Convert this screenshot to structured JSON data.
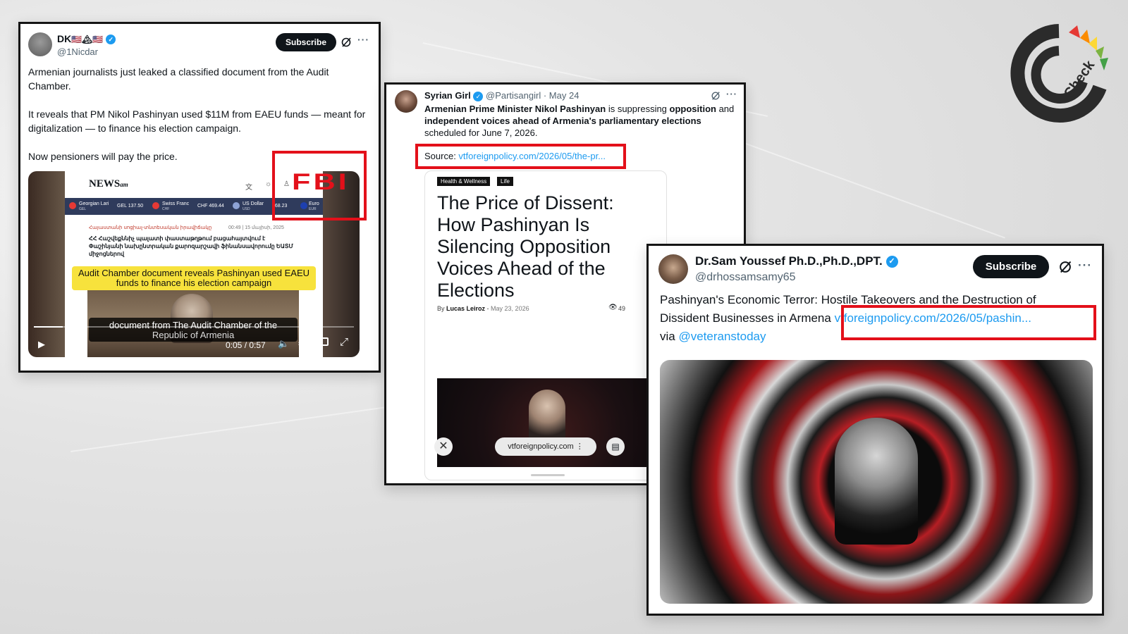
{
  "logo": {
    "letters": "Check"
  },
  "tweet1": {
    "name": "DK",
    "name_flags": "🇺🇸🏔🇺🇸",
    "handle": "@1Nicdar",
    "subscribe": "Subscribe",
    "para1": "Armenian journalists just leaked a classified document from the Audit Chamber.",
    "para2": "It reveals that PM Nikol Pashinyan used $11M from EAEU funds — meant for digitalization — to finance his election campaign.",
    "para3": "Now pensioners will pay the price.",
    "overlay_stamp": "FBI",
    "video": {
      "site_logo": "NEWS",
      "site_logo_suffix": "am",
      "rates": [
        {
          "label": "Georgian Lari",
          "code": "GEL",
          "value": "GEL 137.50"
        },
        {
          "label": "Swiss Franc",
          "code": "CHF",
          "value": "CHF 469.44"
        },
        {
          "label": "US Dollar",
          "code": "USD",
          "value": "368.23"
        },
        {
          "label": "Euro",
          "code": "EUR",
          "value": ""
        }
      ],
      "article_meta": "Հայաստանի սոցիալ-տնտեսական իրավիճակը",
      "article_time": "00:49 | 15 մայիսի, 2025",
      "article_headline": "ՀՀ Հաշվեքննիչ պալատի փաստաթղթում բացահայտվում է Փաշինյանի նախընտրական քարոզարշավի ֆինանսավորումը ԵԱՏՄ միջոցներով",
      "highlight_caption": "Audit Chamber document reveals Pashinyan used EAEU funds to finance his election campaign",
      "subtitle_line1": "document from The Audit Chamber of the",
      "subtitle_line2": "Republic of Armenia",
      "time": "0:05 / 0:57"
    }
  },
  "tweet2": {
    "name": "Syrian Girl",
    "handle": "@Partisangirl",
    "date": "· May 24",
    "text_bold1": "Armenian Prime Minister Nikol Pashinyan",
    "text_mid1": " is suppressing ",
    "text_bold2": "opposition",
    "text_mid2": " and ",
    "text_bold3": "independent voices ahead of Armenia's parliamentary elections",
    "text_end": " scheduled for June 7, 2026.",
    "source_label": "Source: ",
    "source_link": "vtforeignpolicy.com/2026/05/the-pr...",
    "article": {
      "tag1": "Health & Wellness",
      "tag2": "Life",
      "headline": "The Price of Dissent: How Pashinyan Is Silencing Opposition Voices Ahead of the Elections",
      "by": "By",
      "author": "Lucas Leiroz",
      "date": "May 23, 2026",
      "views": "49",
      "url_pill": "vtforeignpolicy.com"
    }
  },
  "tweet3": {
    "name": "Dr.Sam Youssef Ph.D.,Ph.D.,DPT.",
    "handle": "@drhossamsamy65",
    "subscribe": "Subscribe",
    "line1": "Pashinyan's Economic Terror: Hostile Takeovers and the Destruction of",
    "line2_start": "Dissident Businesses in Armen",
    "line2_fragment": "a ",
    "link": "vtforeignpolicy.com/2026/05/pashin...",
    "via": "via ",
    "via_handle": "@veteranstoday"
  }
}
